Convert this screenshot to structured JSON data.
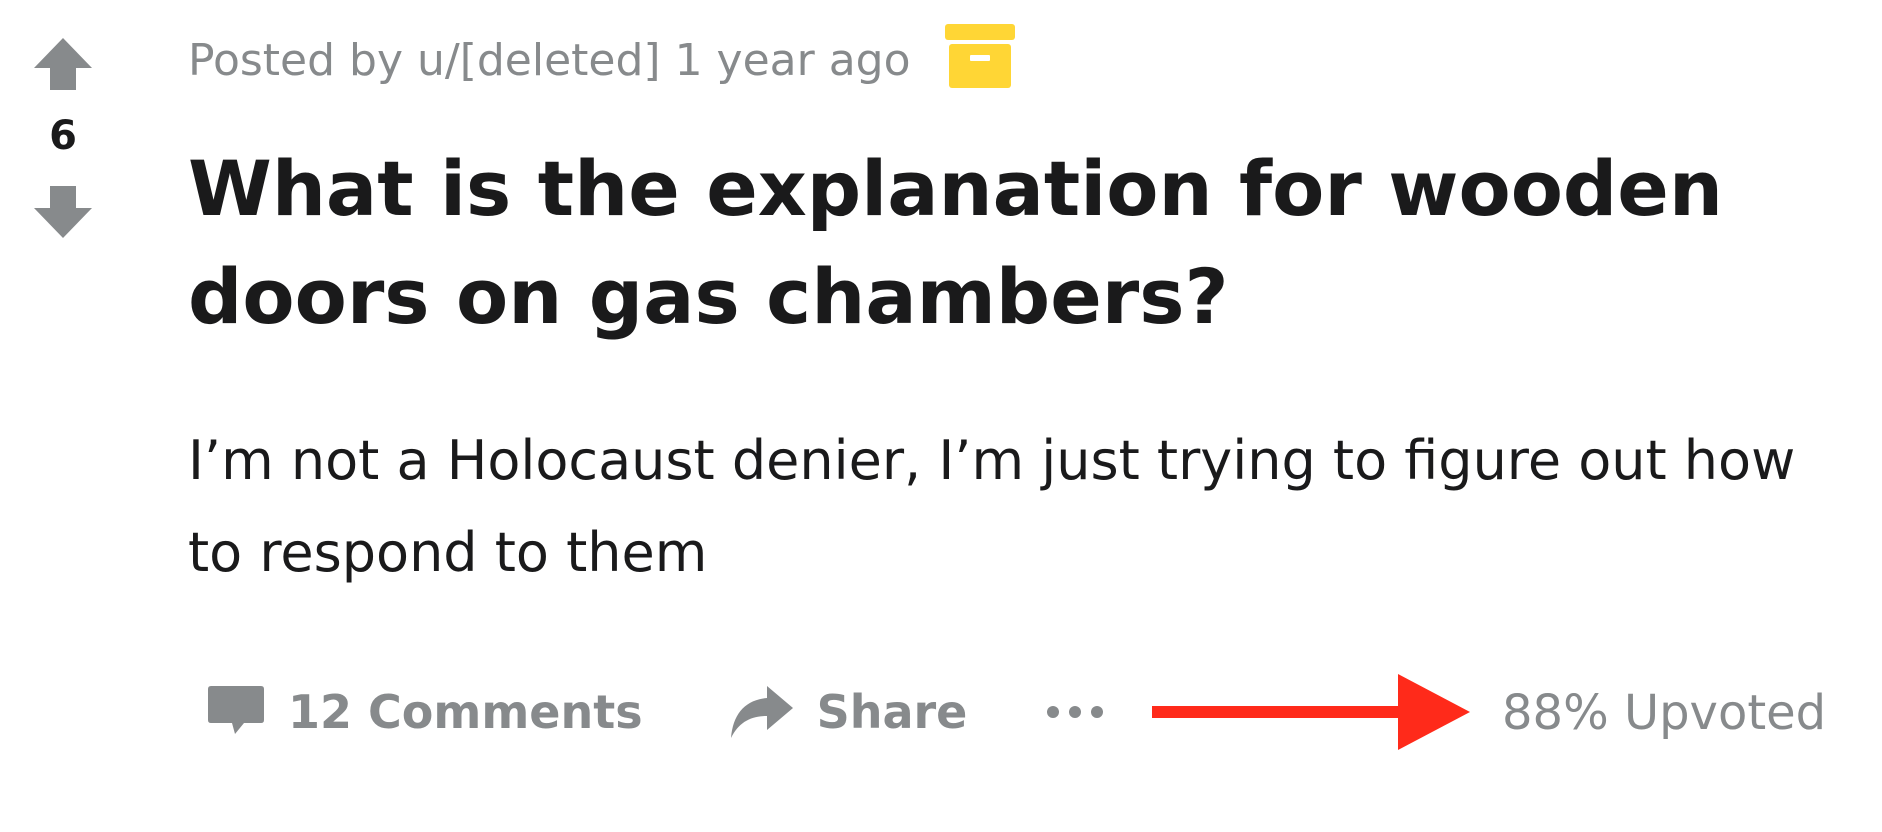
{
  "vote": {
    "count": "6",
    "upvote_icon": "upvote-arrow-icon",
    "downvote_icon": "downvote-arrow-icon"
  },
  "post": {
    "meta": "Posted by u/[deleted] 1 year ago",
    "archived_icon": "archive-box-icon",
    "title": "What is the explanation for wooden doors on gas chambers?",
    "body": "I’m not a Holocaust denier, I’m just trying to figure out how to respond to them"
  },
  "actions": {
    "comments_label": "12 Comments",
    "comments_icon": "comment-bubble-icon",
    "share_label": "Share",
    "share_icon": "share-arrow-icon",
    "more_icon": "ellipsis-icon",
    "upvoted_text": "88% Upvoted"
  },
  "colors": {
    "text_primary": "#1a1a1b",
    "text_muted": "#878a8c",
    "archive_yellow": "#ffd635",
    "annotation_red": "#ff2a1a"
  }
}
